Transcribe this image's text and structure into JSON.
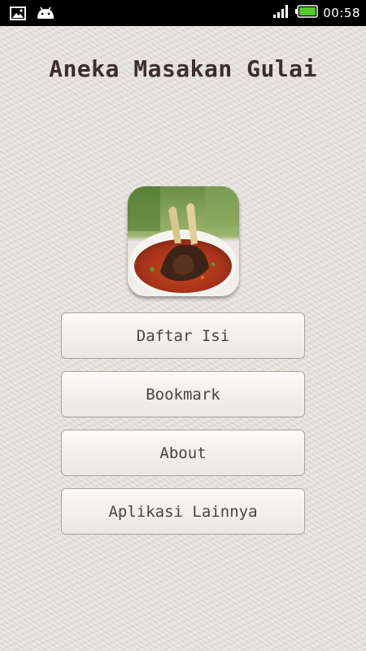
{
  "status_bar": {
    "time": "00:58",
    "icons": [
      "image-notification-icon",
      "android-notification-icon",
      "signal-icon",
      "battery-icon"
    ]
  },
  "app": {
    "title": "Aneka Masakan Gulai"
  },
  "menu": {
    "items": [
      {
        "label": "Daftar Isi"
      },
      {
        "label": "Bookmark"
      },
      {
        "label": "About"
      },
      {
        "label": "Aplikasi Lainnya"
      }
    ]
  },
  "colors": {
    "background": "#e6e1dd",
    "title": "#3b2f2b",
    "button_text": "#4a4340",
    "battery": "#55c82c"
  }
}
